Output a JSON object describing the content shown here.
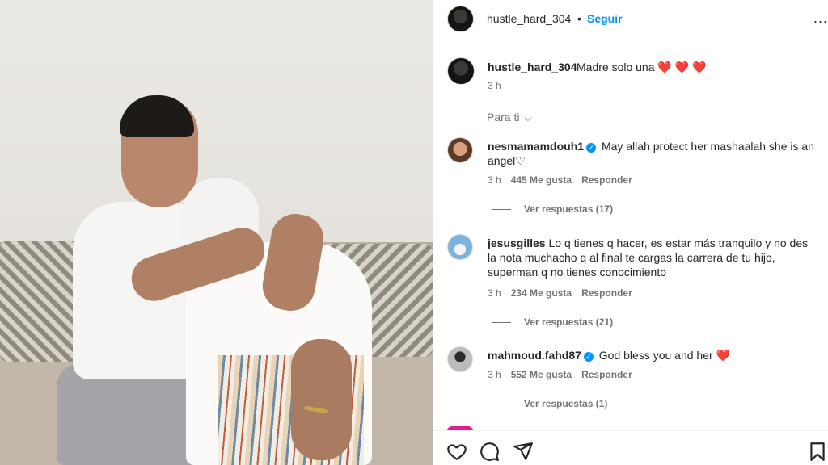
{
  "post": {
    "username": "hustle_hard_304",
    "separator": "•",
    "follow_label": "Seguir",
    "more_label": "...",
    "caption_text": "Madre solo una",
    "caption_hearts": "❤️ ❤️ ❤️",
    "caption_time": "3 h",
    "filter_label": "Para ti"
  },
  "comments": [
    {
      "username": "nesmamamdouh1",
      "verified": true,
      "text": "May allah protect her mashaalah she is an angel♡",
      "time": "3 h",
      "likes": "445 Me gusta",
      "reply_label": "Responder",
      "replies": "Ver respuestas (17)"
    },
    {
      "username": "jesusgilles",
      "verified": false,
      "text": "Lo q tienes q hacer, es estar más tranquilo y no des la nota muchacho q al final te cargas la carrera de tu hijo, superman q no tienes conocimiento",
      "time": "3 h",
      "likes": "234 Me gusta",
      "reply_label": "Responder",
      "replies": "Ver respuestas (21)"
    },
    {
      "username": "mahmoud.fahd87",
      "verified": true,
      "text": "God bless you and her",
      "heart": "❤️",
      "time": "3 h",
      "likes": "552 Me gusta",
      "reply_label": "Responder",
      "replies": "Ver respuestas (1)"
    }
  ],
  "icons": {
    "like": "heart-icon",
    "comment": "comment-icon",
    "share": "share-icon",
    "save": "bookmark-icon",
    "verified": "verified-badge-icon"
  },
  "colors": {
    "accent": "#0095f6",
    "heart": "#e0242f",
    "muted": "#737373"
  }
}
